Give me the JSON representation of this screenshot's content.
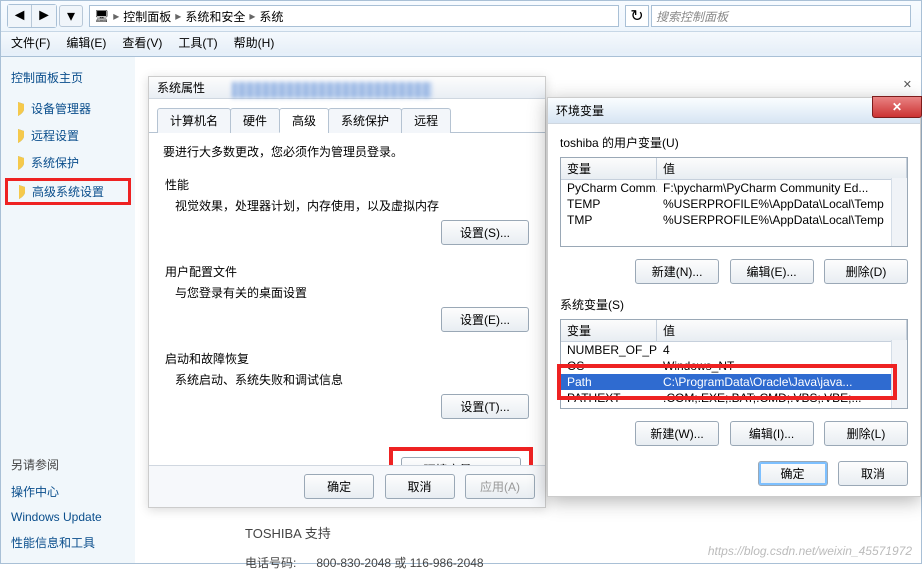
{
  "addressbar": {
    "crumb1": "控制面板",
    "crumb2": "系统和安全",
    "crumb3": "系统",
    "search_placeholder": "搜索控制面板"
  },
  "menubar": {
    "file": "文件(F)",
    "edit": "编辑(E)",
    "view": "查看(V)",
    "tools": "工具(T)",
    "help": "帮助(H)"
  },
  "sidepanel": {
    "home": "控制面板主页",
    "device_manager": "设备管理器",
    "remote": "远程设置",
    "protection": "系统保护",
    "advanced": "高级系统设置",
    "see_also": "另请参阅",
    "action_center": "操作中心",
    "windows_update": "Windows Update",
    "perf": "性能信息和工具"
  },
  "content": {
    "support_title": "TOSHIBA 支持",
    "phone_label": "电话号码:",
    "phone_value": "800-830-2048 或 116-986-2048"
  },
  "sysdlg": {
    "title": "系统属性",
    "tabs": {
      "t1": "计算机名",
      "t2": "硬件",
      "t3": "高级",
      "t4": "系统保护",
      "t5": "远程"
    },
    "note": "要进行大多数更改，您必须作为管理员登录。",
    "perf_title": "性能",
    "perf_desc": "视觉效果，处理器计划，内存使用，以及虚拟内存",
    "btn_settings_s": "设置(S)...",
    "profile_title": "用户配置文件",
    "profile_desc": "与您登录有关的桌面设置",
    "btn_settings_e": "设置(E)...",
    "startup_title": "启动和故障恢复",
    "startup_desc": "系统启动、系统失败和调试信息",
    "btn_settings_t": "设置(T)...",
    "btn_env": "环境变量(N)...",
    "btn_ok": "确定",
    "btn_cancel": "取消",
    "btn_apply": "应用(A)",
    "close_x": "✕"
  },
  "envdlg": {
    "title": "环境变量",
    "user_label": "toshiba 的用户变量(U)",
    "col_var": "变量",
    "col_val": "值",
    "user_rows": [
      {
        "k": "PyCharm Comm...",
        "v": "F:\\pycharm\\PyCharm Community Ed..."
      },
      {
        "k": "TEMP",
        "v": "%USERPROFILE%\\AppData\\Local\\Temp"
      },
      {
        "k": "TMP",
        "v": "%USERPROFILE%\\AppData\\Local\\Temp"
      }
    ],
    "sys_label": "系统变量(S)",
    "sys_rows": [
      {
        "k": "NUMBER_OF_PR...",
        "v": "4"
      },
      {
        "k": "OS",
        "v": "Windows_NT"
      },
      {
        "k": "Path",
        "v": "C:\\ProgramData\\Oracle\\Java\\java...",
        "sel": true
      },
      {
        "k": "PATHEXT",
        "v": ".COM;.EXE;.BAT;.CMD;.VBS;.VBE;..."
      }
    ],
    "btn_new_n": "新建(N)...",
    "btn_edit_e": "编辑(E)...",
    "btn_del_d": "删除(D)",
    "btn_new_w": "新建(W)...",
    "btn_edit_i": "编辑(I)...",
    "btn_del_l": "删除(L)",
    "btn_ok": "确定",
    "btn_cancel": "取消",
    "close_x": "✕"
  },
  "watermark": "https://blog.csdn.net/weixin_45571972"
}
